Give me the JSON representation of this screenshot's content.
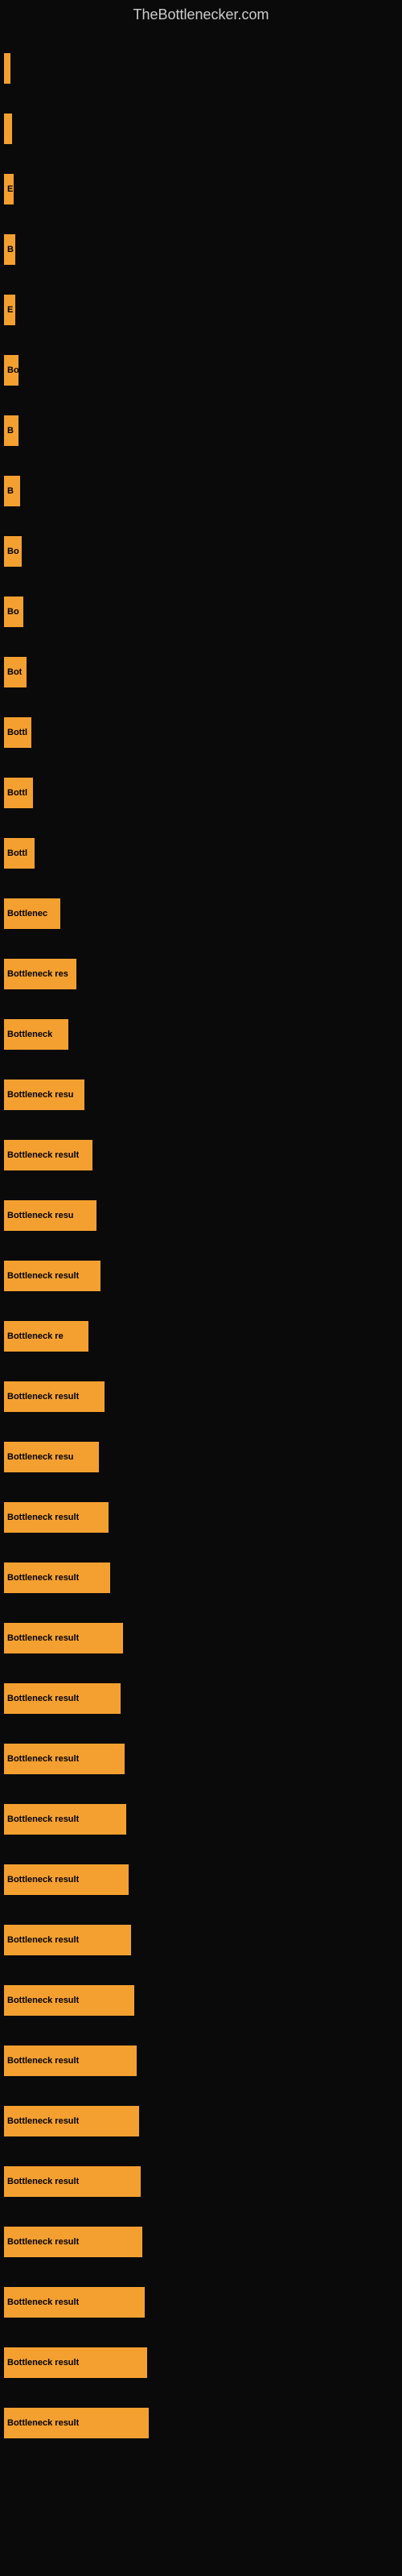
{
  "site": {
    "title": "TheBottlenecker.com"
  },
  "bars": [
    {
      "id": 1,
      "width": 8,
      "label": ""
    },
    {
      "id": 2,
      "width": 10,
      "label": ""
    },
    {
      "id": 3,
      "width": 12,
      "label": "E"
    },
    {
      "id": 4,
      "width": 14,
      "label": "B"
    },
    {
      "id": 5,
      "width": 14,
      "label": "E"
    },
    {
      "id": 6,
      "width": 18,
      "label": "Bo"
    },
    {
      "id": 7,
      "width": 18,
      "label": "B"
    },
    {
      "id": 8,
      "width": 20,
      "label": "B"
    },
    {
      "id": 9,
      "width": 22,
      "label": "Bo"
    },
    {
      "id": 10,
      "width": 24,
      "label": "Bo"
    },
    {
      "id": 11,
      "width": 28,
      "label": "Bot"
    },
    {
      "id": 12,
      "width": 34,
      "label": "Bottl"
    },
    {
      "id": 13,
      "width": 36,
      "label": "Bottl"
    },
    {
      "id": 14,
      "width": 38,
      "label": "Bottl"
    },
    {
      "id": 15,
      "width": 70,
      "label": "Bottlenec"
    },
    {
      "id": 16,
      "width": 90,
      "label": "Bottleneck res"
    },
    {
      "id": 17,
      "width": 80,
      "label": "Bottleneck"
    },
    {
      "id": 18,
      "width": 100,
      "label": "Bottleneck resu"
    },
    {
      "id": 19,
      "width": 110,
      "label": "Bottleneck result"
    },
    {
      "id": 20,
      "width": 115,
      "label": "Bottleneck resu"
    },
    {
      "id": 21,
      "width": 120,
      "label": "Bottleneck result"
    },
    {
      "id": 22,
      "width": 105,
      "label": "Bottleneck re"
    },
    {
      "id": 23,
      "width": 125,
      "label": "Bottleneck result"
    },
    {
      "id": 24,
      "width": 118,
      "label": "Bottleneck resu"
    },
    {
      "id": 25,
      "width": 130,
      "label": "Bottleneck result"
    },
    {
      "id": 26,
      "width": 132,
      "label": "Bottleneck result"
    },
    {
      "id": 27,
      "width": 148,
      "label": "Bottleneck result"
    },
    {
      "id": 28,
      "width": 145,
      "label": "Bottleneck result"
    },
    {
      "id": 29,
      "width": 150,
      "label": "Bottleneck result"
    },
    {
      "id": 30,
      "width": 152,
      "label": "Bottleneck result"
    },
    {
      "id": 31,
      "width": 155,
      "label": "Bottleneck result"
    },
    {
      "id": 32,
      "width": 158,
      "label": "Bottleneck result"
    },
    {
      "id": 33,
      "width": 162,
      "label": "Bottleneck result"
    },
    {
      "id": 34,
      "width": 165,
      "label": "Bottleneck result"
    },
    {
      "id": 35,
      "width": 168,
      "label": "Bottleneck result"
    },
    {
      "id": 36,
      "width": 170,
      "label": "Bottleneck result"
    },
    {
      "id": 37,
      "width": 172,
      "label": "Bottleneck result"
    },
    {
      "id": 38,
      "width": 175,
      "label": "Bottleneck result"
    },
    {
      "id": 39,
      "width": 178,
      "label": "Bottleneck result"
    },
    {
      "id": 40,
      "width": 180,
      "label": "Bottleneck result"
    }
  ]
}
